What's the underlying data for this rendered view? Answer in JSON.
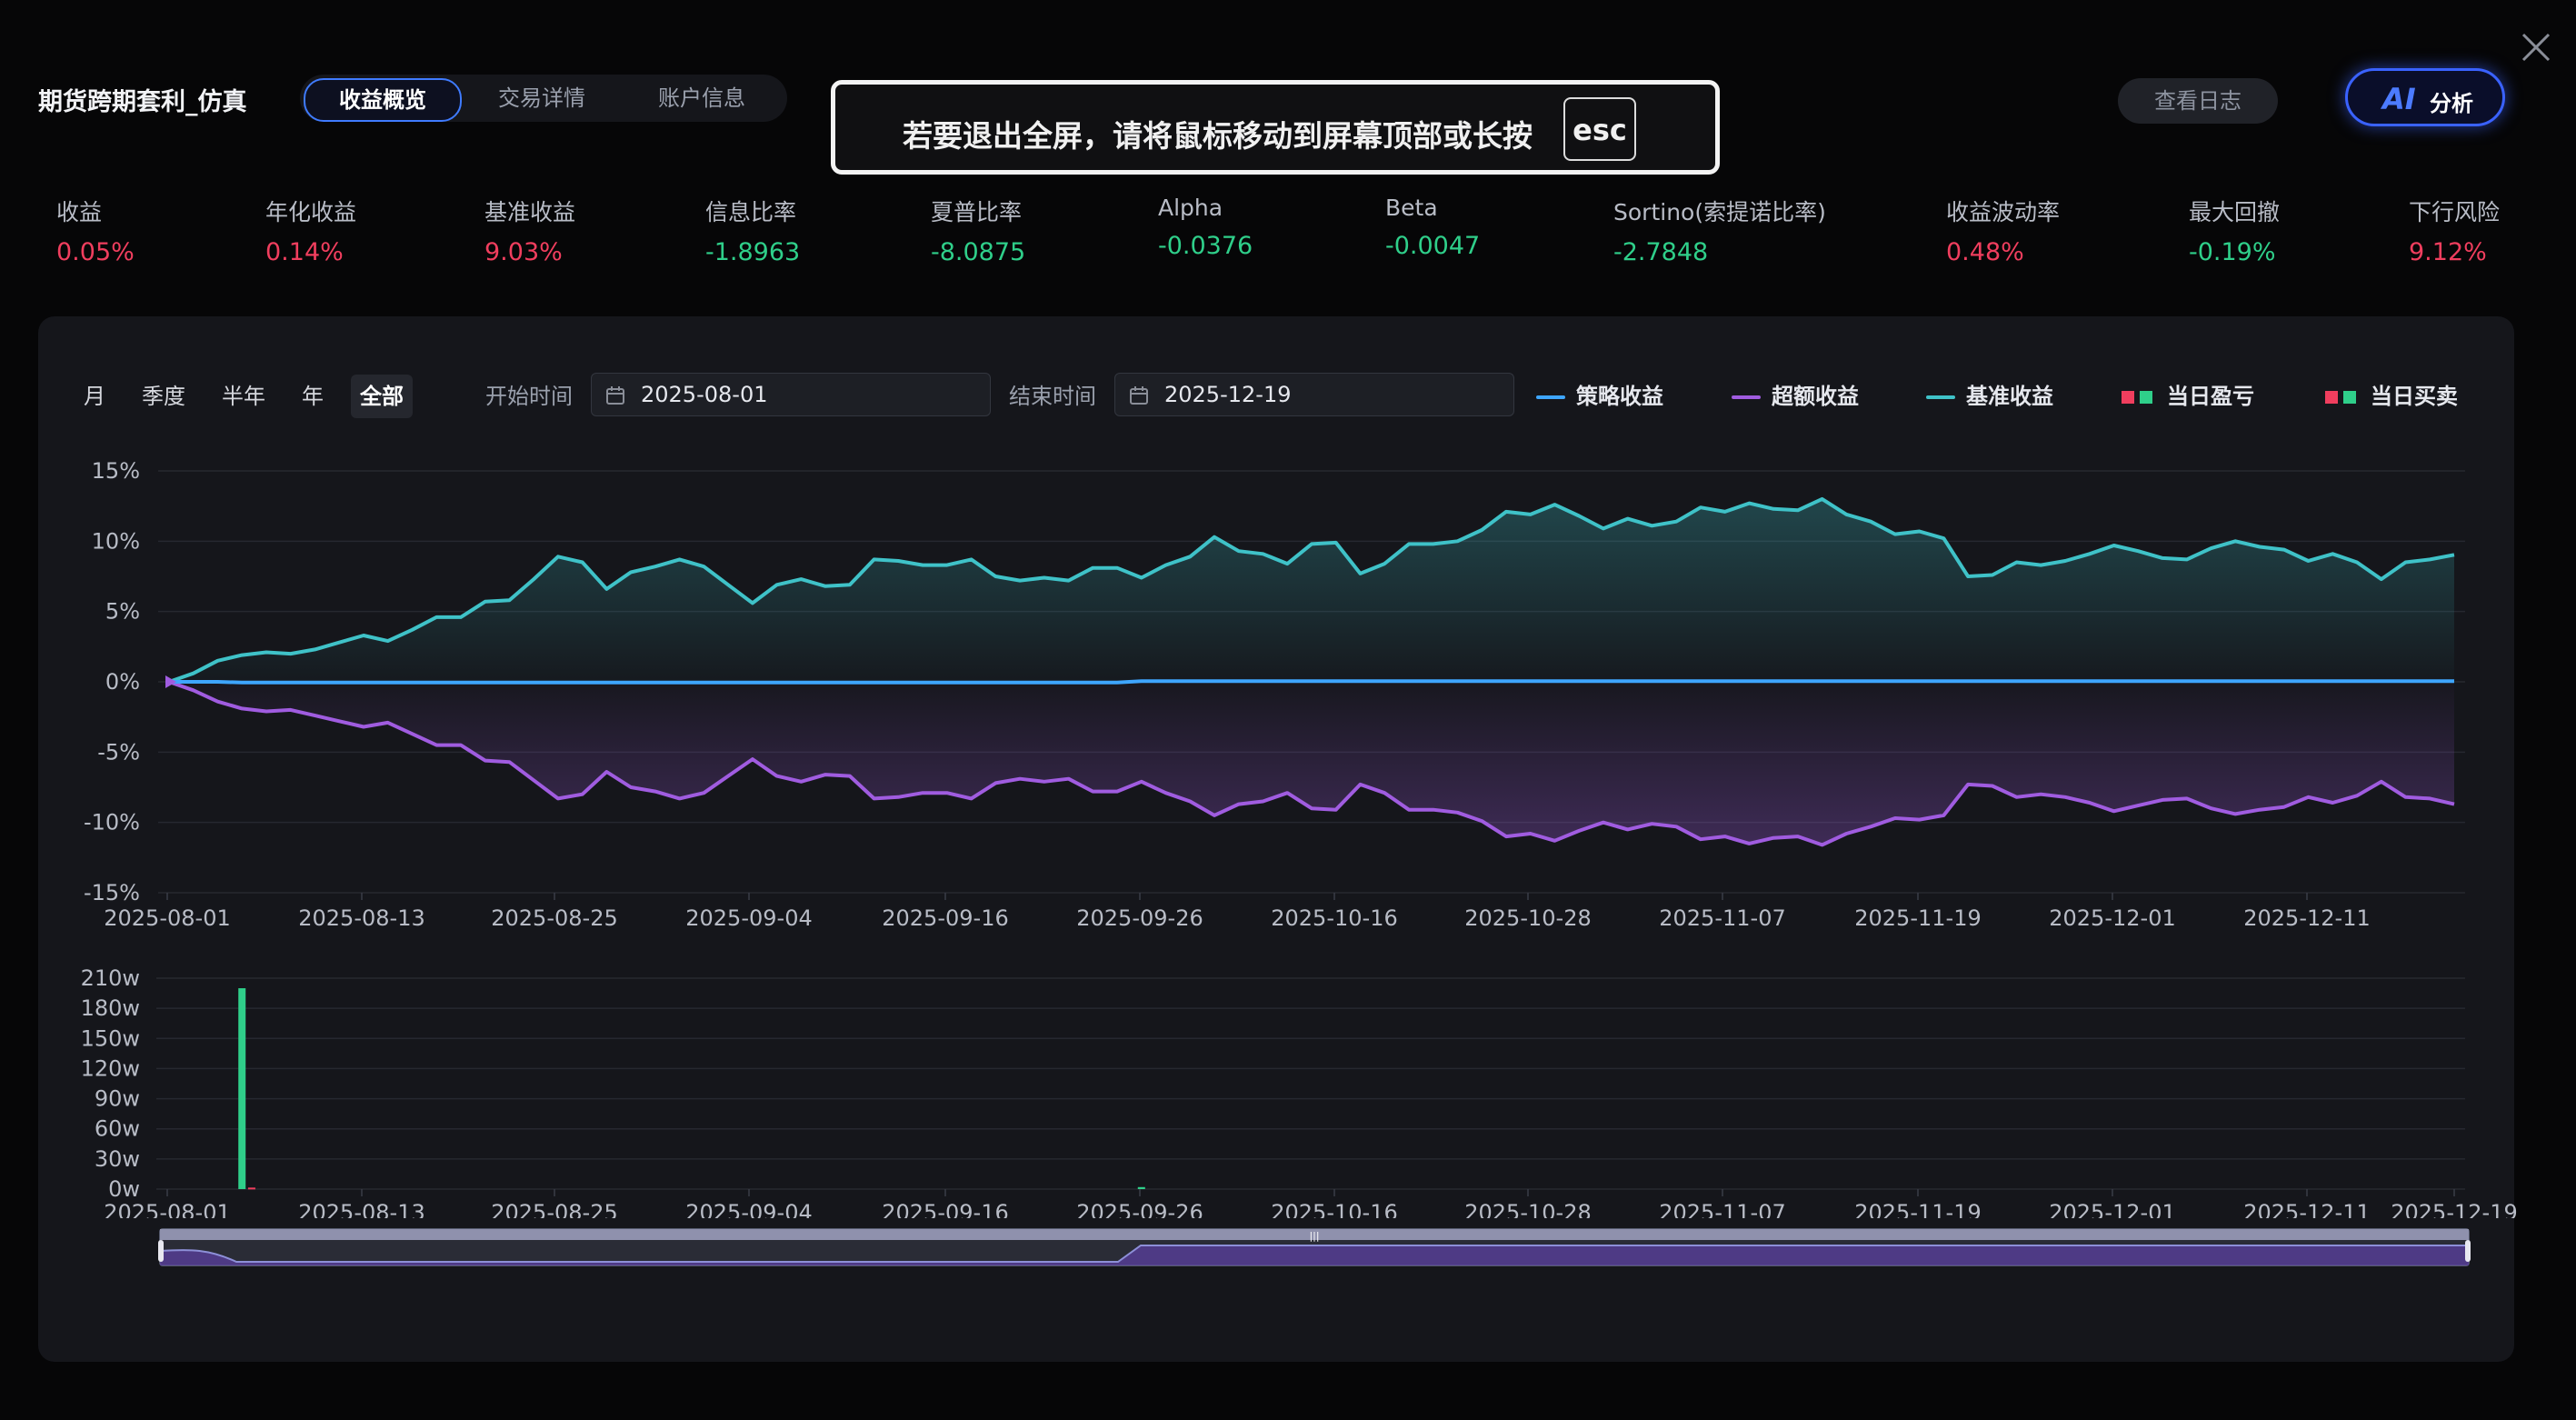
{
  "header": {
    "title": "期货跨期套利_仿真",
    "tabs": [
      {
        "label": "收益概览",
        "active": true
      },
      {
        "label": "交易详情",
        "active": false
      },
      {
        "label": "账户信息",
        "active": false
      }
    ],
    "log_button": "查看日志",
    "ai_button": {
      "icon_text": "AI",
      "label": "分析"
    }
  },
  "fullscreen_hint": {
    "text": "若要退出全屏，请将鼠标移动到屏幕顶部或长按",
    "key": "esc"
  },
  "metrics": [
    {
      "label": "收益",
      "value": "0.05%",
      "tone": "red"
    },
    {
      "label": "年化收益",
      "value": "0.14%",
      "tone": "red"
    },
    {
      "label": "基准收益",
      "value": "9.03%",
      "tone": "red"
    },
    {
      "label": "信息比率",
      "value": "-1.8963",
      "tone": "green"
    },
    {
      "label": "夏普比率",
      "value": "-8.0875",
      "tone": "green"
    },
    {
      "label": "Alpha",
      "value": "-0.0376",
      "tone": "green"
    },
    {
      "label": "Beta",
      "value": "-0.0047",
      "tone": "green"
    },
    {
      "label": "Sortino(索提诺比率)",
      "value": "-2.7848",
      "tone": "green"
    },
    {
      "label": "收益波动率",
      "value": "0.48%",
      "tone": "red"
    },
    {
      "label": "最大回撤",
      "value": "-0.19%",
      "tone": "green"
    },
    {
      "label": "下行风险",
      "value": "9.12%",
      "tone": "red"
    }
  ],
  "controls": {
    "ranges": [
      {
        "label": "月",
        "active": false
      },
      {
        "label": "季度",
        "active": false
      },
      {
        "label": "半年",
        "active": false
      },
      {
        "label": "年",
        "active": false
      },
      {
        "label": "全部",
        "active": true
      }
    ],
    "start_label": "开始时间",
    "start_value": "2025-08-01",
    "end_label": "结束时间",
    "end_value": "2025-12-19"
  },
  "legend": [
    {
      "name": "策略收益",
      "color": "#3ea6ff",
      "kind": "line"
    },
    {
      "name": "超额收益",
      "color": "#a05ce0",
      "kind": "line"
    },
    {
      "name": "基准收益",
      "color": "#3fc2c8",
      "kind": "line"
    },
    {
      "name": "当日盈亏",
      "colors": [
        "#f03e5e",
        "#2fcf8a"
      ],
      "kind": "squares"
    },
    {
      "name": "当日买卖",
      "colors": [
        "#f03e5e",
        "#2fcf8a"
      ],
      "kind": "squares"
    }
  ],
  "chart_data": [
    {
      "type": "line",
      "y_unit": "%",
      "ylim": [
        -15,
        15
      ],
      "yticks": [
        "15%",
        "10%",
        "5%",
        "0%",
        "-5%",
        "-10%",
        "-15%"
      ],
      "xticks": [
        "2025-08-01",
        "2025-08-13",
        "2025-08-25",
        "2025-09-04",
        "2025-09-16",
        "2025-09-26",
        "2025-10-16",
        "2025-10-28",
        "2025-11-07",
        "2025-11-19",
        "2025-12-01",
        "2025-12-11"
      ],
      "grid": true,
      "series": [
        {
          "name": "基准收益",
          "color": "#3fc2c8",
          "values": [
            0,
            0.6,
            1.5,
            1.9,
            2.1,
            2.0,
            2.3,
            2.8,
            3.3,
            2.9,
            3.7,
            4.6,
            4.6,
            5.7,
            5.8,
            7.3,
            8.9,
            8.5,
            6.6,
            7.8,
            8.2,
            8.7,
            8.2,
            6.9,
            5.6,
            6.9,
            7.3,
            6.8,
            6.9,
            8.7,
            8.6,
            8.3,
            8.3,
            8.7,
            7.5,
            7.2,
            7.4,
            7.2,
            8.1,
            8.1,
            7.4,
            8.3,
            8.9,
            10.3,
            9.3,
            9.1,
            8.4,
            9.8,
            9.9,
            7.7,
            8.4,
            9.8,
            9.8,
            10.0,
            10.8,
            12.1,
            11.9,
            12.6,
            11.8,
            10.9,
            11.6,
            11.1,
            11.4,
            12.4,
            12.1,
            12.7,
            12.3,
            12.2,
            13.0,
            11.9,
            11.4,
            10.5,
            10.7,
            10.2,
            7.5,
            7.6,
            8.5,
            8.3,
            8.6,
            9.1,
            9.7,
            9.3,
            8.8,
            8.7,
            9.5,
            10.0,
            9.6,
            9.4,
            8.6,
            9.1,
            8.5,
            7.3,
            8.5,
            8.7,
            9.03
          ]
        },
        {
          "name": "超额收益",
          "color": "#a05ce0",
          "values": [
            0,
            -0.6,
            -1.4,
            -1.9,
            -2.1,
            -2.0,
            -2.4,
            -2.8,
            -3.2,
            -2.9,
            -3.7,
            -4.5,
            -4.5,
            -5.6,
            -5.7,
            -7.0,
            -8.3,
            -8.0,
            -6.4,
            -7.5,
            -7.8,
            -8.3,
            -7.9,
            -6.7,
            -5.5,
            -6.7,
            -7.1,
            -6.6,
            -6.7,
            -8.3,
            -8.2,
            -7.9,
            -7.9,
            -8.3,
            -7.2,
            -6.9,
            -7.1,
            -6.9,
            -7.8,
            -7.8,
            -7.1,
            -7.9,
            -8.5,
            -9.5,
            -8.7,
            -8.5,
            -7.9,
            -9.0,
            -9.1,
            -7.3,
            -7.9,
            -9.1,
            -9.1,
            -9.3,
            -9.9,
            -11.0,
            -10.8,
            -11.3,
            -10.6,
            -10.0,
            -10.5,
            -10.1,
            -10.3,
            -11.2,
            -11.0,
            -11.5,
            -11.1,
            -11.0,
            -11.6,
            -10.8,
            -10.3,
            -9.7,
            -9.8,
            -9.5,
            -7.3,
            -7.4,
            -8.2,
            -8.0,
            -8.2,
            -8.6,
            -9.2,
            -8.8,
            -8.4,
            -8.3,
            -9.0,
            -9.4,
            -9.1,
            -8.9,
            -8.2,
            -8.6,
            -8.1,
            -7.1,
            -8.2,
            -8.3,
            -8.7
          ]
        },
        {
          "name": "策略收益",
          "color": "#3ea6ff",
          "values": [
            0,
            0,
            0,
            -0.05,
            -0.05,
            -0.05,
            -0.05,
            -0.05,
            -0.05,
            -0.05,
            -0.05,
            -0.05,
            -0.05,
            -0.05,
            -0.05,
            -0.05,
            -0.05,
            -0.05,
            -0.05,
            -0.05,
            -0.05,
            -0.05,
            -0.05,
            -0.05,
            -0.05,
            -0.05,
            -0.05,
            -0.05,
            -0.05,
            -0.05,
            -0.05,
            -0.05,
            -0.05,
            -0.05,
            -0.05,
            -0.05,
            -0.05,
            -0.05,
            -0.05,
            -0.05,
            0.05,
            0.05,
            0.05,
            0.05,
            0.05,
            0.05,
            0.05,
            0.05,
            0.05,
            0.05,
            0.05,
            0.05,
            0.05,
            0.05,
            0.05,
            0.05,
            0.05,
            0.05,
            0.05,
            0.05,
            0.05,
            0.05,
            0.05,
            0.05,
            0.05,
            0.05,
            0.05,
            0.05,
            0.05,
            0.05,
            0.05,
            0.05,
            0.05,
            0.05,
            0.05,
            0.05,
            0.05,
            0.05,
            0.05,
            0.05,
            0.05,
            0.05,
            0.05,
            0.05,
            0.05,
            0.05,
            0.05,
            0.05,
            0.05,
            0.05,
            0.05,
            0.05,
            0.05,
            0.05,
            0.05
          ]
        }
      ]
    },
    {
      "type": "bar",
      "y_unit": "w",
      "ylim": [
        0,
        210
      ],
      "yticks": [
        "210w",
        "180w",
        "150w",
        "120w",
        "90w",
        "60w",
        "30w",
        "0w"
      ],
      "xticks": [
        "2025-08-01",
        "2025-08-13",
        "2025-08-25",
        "2025-09-04",
        "2025-09-16",
        "2025-09-26",
        "2025-10-16",
        "2025-10-28",
        "2025-11-07",
        "2025-11-19",
        "2025-12-01",
        "2025-12-11",
        "2025-12-19"
      ],
      "grid": true,
      "bars": [
        {
          "index": 3,
          "value": 200,
          "color": "#2fcf8a"
        },
        {
          "index": 3.4,
          "value": 1.5,
          "color": "#f03e5e"
        },
        {
          "index": 40,
          "value": 2,
          "color": "#2fcf8a"
        }
      ]
    }
  ]
}
